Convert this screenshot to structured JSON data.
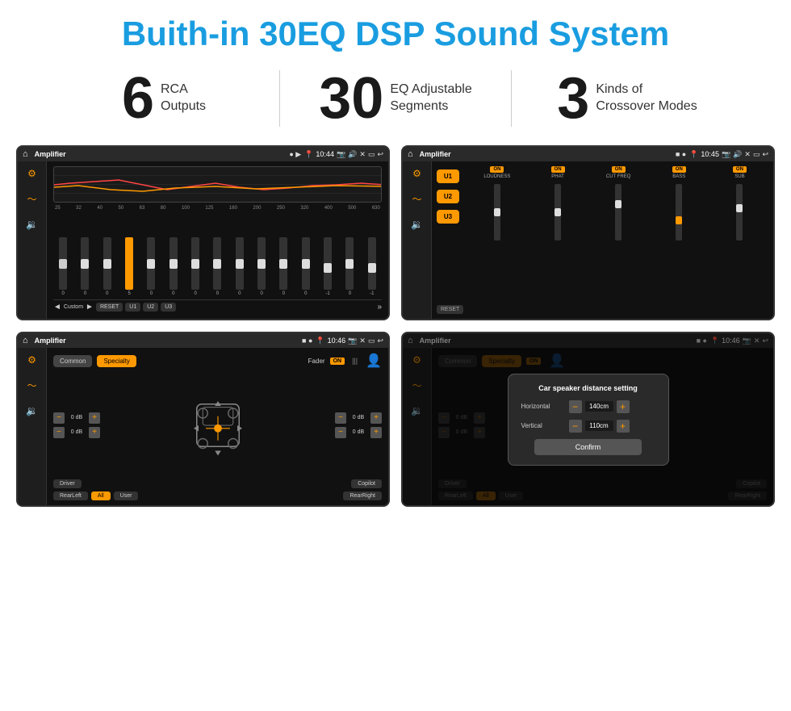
{
  "header": {
    "title": "Buith-in 30EQ DSP Sound System"
  },
  "stats": [
    {
      "number": "6",
      "label": "RCA\nOutputs",
      "label_line1": "RCA",
      "label_line2": "Outputs"
    },
    {
      "number": "30",
      "label": "EQ Adjustable\nSegments",
      "label_line1": "EQ Adjustable",
      "label_line2": "Segments"
    },
    {
      "number": "3",
      "label": "Kinds of\nCrossover Modes",
      "label_line1": "Kinds of",
      "label_line2": "Crossover Modes"
    }
  ],
  "screens": {
    "eq": {
      "status_bar": {
        "app": "Amplifier",
        "time": "10:44"
      },
      "freq_labels": [
        "25",
        "32",
        "40",
        "50",
        "63",
        "80",
        "100",
        "125",
        "160",
        "200",
        "250",
        "320",
        "400",
        "500",
        "630"
      ],
      "slider_values": [
        "0",
        "0",
        "0",
        "5",
        "0",
        "0",
        "0",
        "0",
        "0",
        "0",
        "0",
        "0",
        "-1",
        "0",
        "-1"
      ],
      "bottom_buttons": [
        "Custom",
        "RESET",
        "U1",
        "U2",
        "U3"
      ]
    },
    "crossover": {
      "status_bar": {
        "app": "Amplifier",
        "time": "10:45"
      },
      "u_buttons": [
        "U1",
        "U2",
        "U3"
      ],
      "controls": [
        {
          "on": true,
          "label": "LOUDNESS"
        },
        {
          "on": true,
          "label": "PHAT"
        },
        {
          "on": true,
          "label": "CUT FREQ"
        },
        {
          "on": true,
          "label": "BASS"
        },
        {
          "on": true,
          "label": "SUB"
        }
      ]
    },
    "fader": {
      "status_bar": {
        "app": "Amplifier",
        "time": "10:46"
      },
      "tabs": [
        "Common",
        "Specialty"
      ],
      "fader_label": "Fader",
      "db_values": [
        "0 dB",
        "0 dB",
        "0 dB",
        "0 dB"
      ],
      "bottom_buttons": [
        "Driver",
        "Copilot",
        "RearLeft",
        "All",
        "User",
        "RearRight"
      ],
      "active_tab": "Specialty",
      "active_bottom": "All"
    },
    "dialog": {
      "status_bar": {
        "app": "Amplifier",
        "time": "10:46"
      },
      "tabs": [
        "Common",
        "Specialty"
      ],
      "dialog": {
        "title": "Car speaker distance setting",
        "horizontal_label": "Horizontal",
        "horizontal_value": "140cm",
        "vertical_label": "Vertical",
        "vertical_value": "110cm",
        "confirm_label": "Confirm"
      },
      "db_values": [
        "0 dB",
        "0 dB"
      ],
      "bottom_buttons": [
        "Driver",
        "Copilot",
        "RearLeft",
        "All",
        "User",
        "RearRight"
      ]
    }
  }
}
